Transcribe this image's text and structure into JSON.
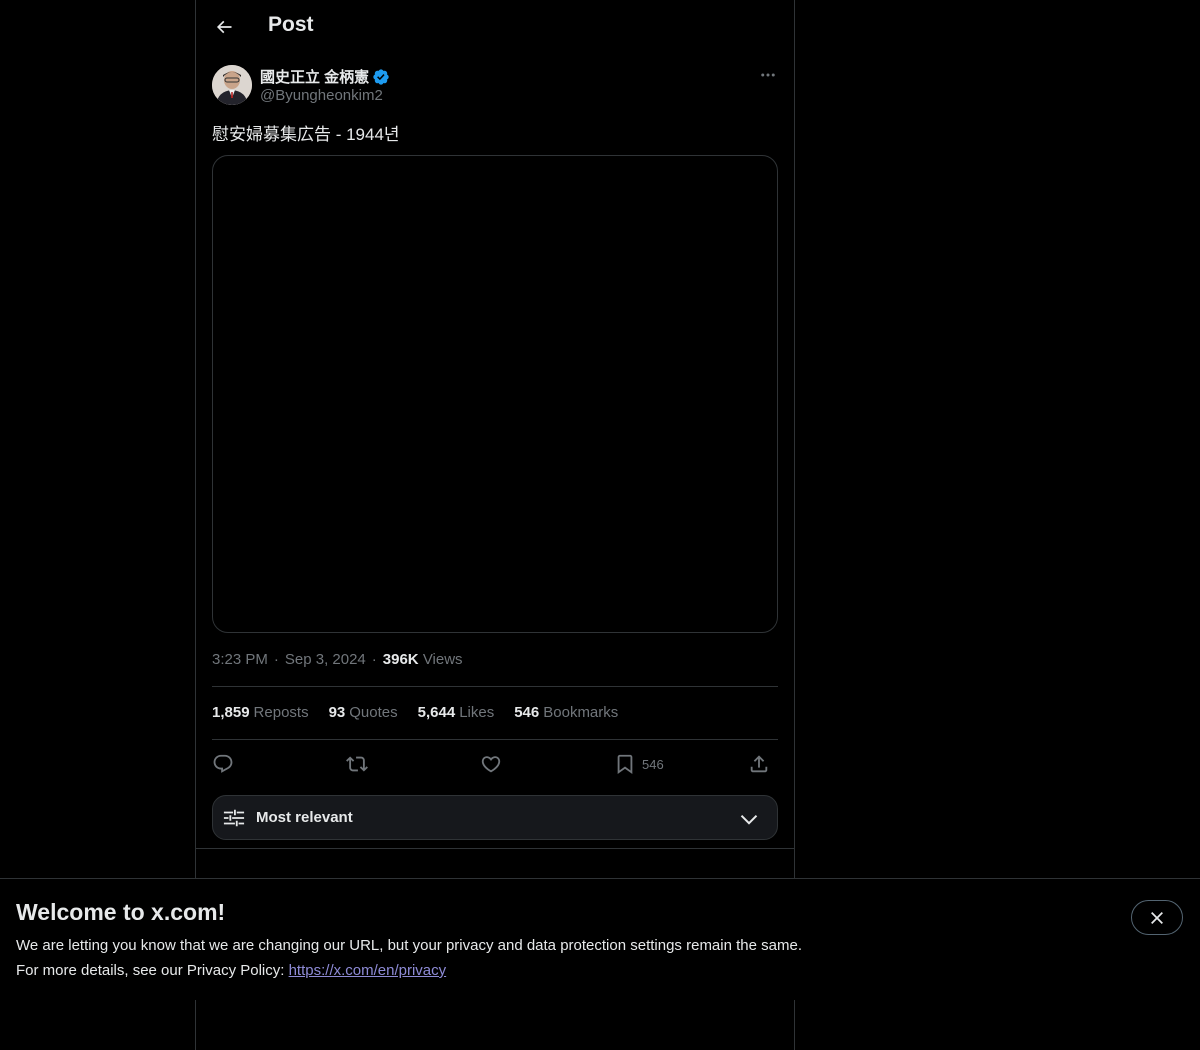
{
  "header": {
    "back_icon": "arrow-left-icon",
    "title": "Post"
  },
  "post": {
    "author": {
      "name": "國史正立 金柄憲",
      "handle": "@Byungheonkim2",
      "verified": true,
      "verified_color": "#1d9bf0"
    },
    "text": "慰安婦募集広告 - 1944년",
    "meta": {
      "time": "3:23 PM",
      "separator1": "·",
      "date": "Sep 3, 2024",
      "separator2": "·",
      "views_count": "396K",
      "views_label": "Views"
    },
    "stats": [
      {
        "count": "1,859",
        "label": "Reposts"
      },
      {
        "count": "93",
        "label": "Quotes"
      },
      {
        "count": "5,644",
        "label": "Likes"
      },
      {
        "count": "546",
        "label": "Bookmarks"
      }
    ],
    "actions": {
      "reply_icon": "reply-icon",
      "repost_icon": "repost-icon",
      "like_icon": "heart-icon",
      "bookmark_icon": "bookmark-icon",
      "bookmark_count": "546",
      "share_icon": "share-icon"
    }
  },
  "replies_sort": {
    "label": "Most relevant",
    "icon": "sliders-icon",
    "chevron": "chevron-down-icon"
  },
  "banner": {
    "title": "Welcome to x.com!",
    "line1": "We are letting you know that we are changing our URL, but your privacy and data protection settings remain the same.",
    "line2_prefix": "For more details, see our Privacy Policy: ",
    "link_text": "https://x.com/en/privacy",
    "close_icon": "close-icon"
  },
  "colors": {
    "background": "#000000",
    "text_primary": "#e7e9ea",
    "text_secondary": "#71767b",
    "border": "#2f3336",
    "link": "#8e8bd6"
  }
}
